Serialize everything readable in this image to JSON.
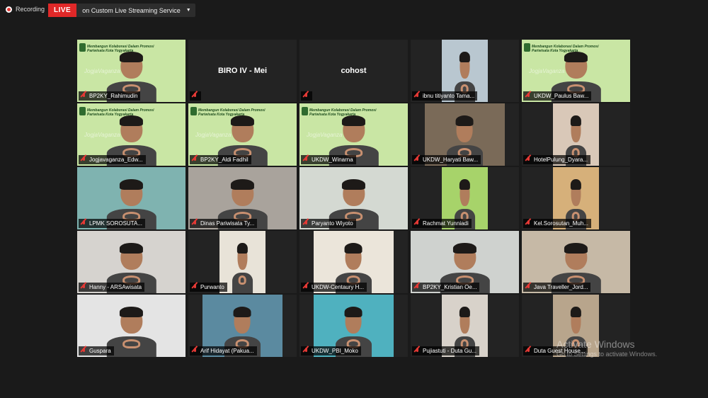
{
  "recording": {
    "label": "Recording"
  },
  "live": {
    "badge": "LIVE",
    "service": "on Custom Live Streaming Service"
  },
  "colors": {
    "speaking_border": "#8bc540",
    "mic_muted": "#e53935",
    "live_red": "#e02828",
    "banner_green": "#c9e6a4"
  },
  "banner": {
    "title": "Membangun Kolaborasi Dalam Promosi Pariwisata Kota Yogyakarta",
    "watermark": "JogjaVaganza"
  },
  "participants": [
    {
      "name": "BP2KY_Rahimudin",
      "kind": "banner",
      "bg": "#c9e6a4",
      "speaking": true,
      "muted": true
    },
    {
      "name": "BIRO IV - Mei",
      "kind": "name"
    },
    {
      "name": "cohost",
      "kind": "name"
    },
    {
      "name": "ibnu titiyanto Tama...",
      "kind": "narrow",
      "bg": "#b9c7d0"
    },
    {
      "name": "UKDW_Paulus Baw...",
      "kind": "banner",
      "bg": "#c9e6a4"
    },
    {
      "name": "Jogjavaganza_Edw...",
      "kind": "banner",
      "bg": "#c9e6a4"
    },
    {
      "name": "BP2KY_Aldi Fadhil",
      "kind": "banner",
      "bg": "#c9e6a4"
    },
    {
      "name": "UKDW_Winarna",
      "kind": "banner",
      "bg": "#c9e6a4"
    },
    {
      "name": "UKDW_Haryati Baw...",
      "kind": "mid",
      "bg": "#7a6a58"
    },
    {
      "name": "HotelPulung_Dyara...",
      "kind": "narrow",
      "bg": "#d9c8b8"
    },
    {
      "name": "LPMK SOROSUTA...",
      "kind": "full",
      "bg": "#7fb3b0"
    },
    {
      "name": "Dinas Pariwisata Ty...",
      "kind": "full",
      "bg": "#a9a39c"
    },
    {
      "name": "Paryanto Wiyoto",
      "kind": "full",
      "bg": "#d4d9d2"
    },
    {
      "name": "Rachmat Yunniadi",
      "kind": "narrow",
      "bg": "#a7d36a"
    },
    {
      "name": "Kel.Sorosutan_Muh...",
      "kind": "narrow",
      "bg": "#d6b07a"
    },
    {
      "name": "Hanny - ARSAwisata",
      "kind": "full",
      "bg": "#d6d3cf"
    },
    {
      "name": "Purwanto",
      "kind": "narrow",
      "bg": "#e8e3d8"
    },
    {
      "name": "UKDW-Centaury H...",
      "kind": "mid",
      "bg": "#ebe5da"
    },
    {
      "name": "BP2KY_Kristian Oe...",
      "kind": "full",
      "bg": "#cfd2cf"
    },
    {
      "name": "Java Traveller_Jord...",
      "kind": "full",
      "bg": "#c6b9a6"
    },
    {
      "name": "Guspara",
      "kind": "full",
      "bg": "#e4e4e4"
    },
    {
      "name": "Arif Hidayat (Pakua...",
      "kind": "mid",
      "bg": "#5b8aa0"
    },
    {
      "name": "UKDW_PBI_Moko",
      "kind": "mid",
      "bg": "#4fb1bf"
    },
    {
      "name": "Pujiastuti - Duta Gu...",
      "kind": "narrow",
      "bg": "#d8d2ca"
    },
    {
      "name": "Duta Guest House...",
      "kind": "narrow",
      "bg": "#b8a58c"
    }
  ],
  "watermark": {
    "title": "Activate Windows",
    "subtitle": "Go to Settings to activate Windows."
  }
}
